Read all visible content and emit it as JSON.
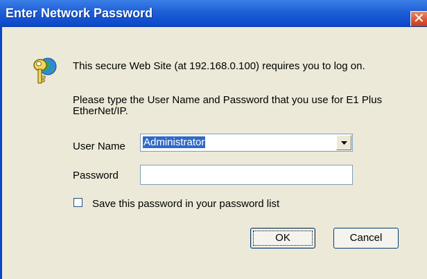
{
  "dialog": {
    "title": "Enter Network Password",
    "close_glyph": "✕",
    "icon": "key-icon",
    "message_logon": "This secure Web Site (at 192.168.0.100) requires you to log on.",
    "message_instructions": "Please type the User Name and Password that you use for E1 Plus EtherNet/IP."
  },
  "form": {
    "user_name_label": "User Name",
    "user_name_value": "Administrator",
    "password_label": "Password",
    "password_value": "",
    "save_password_label": "Save this password in your password list",
    "save_password_checked": false
  },
  "buttons": {
    "ok_label": "OK",
    "cancel_label": "Cancel"
  },
  "colors": {
    "titlebar": "#0a47c8",
    "dialog_background": "#ece9d8",
    "selection": "#316ac5",
    "close_button": "#d9532f"
  }
}
